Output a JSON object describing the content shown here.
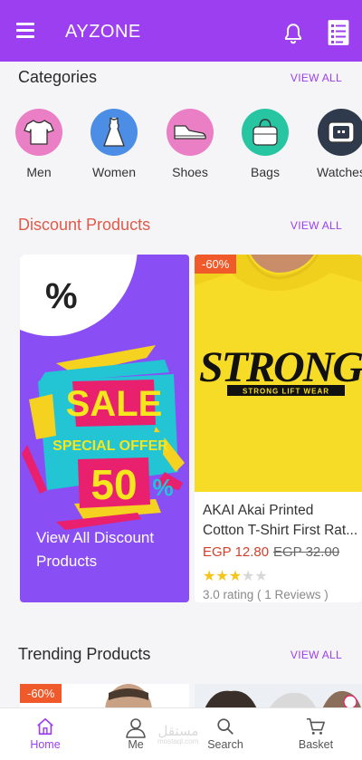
{
  "header": {
    "title": "AYZONE",
    "icons": [
      "menu-icon",
      "bell-icon",
      "list-icon"
    ]
  },
  "categories": {
    "title": "Categories",
    "view_all": "VIEW ALL",
    "items": [
      {
        "label": "Men",
        "icon": "tshirt-icon",
        "color": "#ea7fc5"
      },
      {
        "label": "Women",
        "icon": "dress-icon",
        "color": "#4c8ee6"
      },
      {
        "label": "Shoes",
        "icon": "shoe-icon",
        "color": "#ea7fc5"
      },
      {
        "label": "Bags",
        "icon": "bag-icon",
        "color": "#27c5a2"
      },
      {
        "label": "Watches",
        "icon": "watch-icon",
        "color": "#2f3b4d"
      }
    ]
  },
  "discount": {
    "title": "Discount Products",
    "view_all": "VIEW ALL",
    "title_color": "#e05a4a",
    "promo": {
      "percent_symbol": "%",
      "sale": "SALE",
      "special_offer": "SPECIAL OFFER",
      "fifty": "50",
      "fifty_pct": "%",
      "link_text": "View All Discount Products"
    },
    "product": {
      "badge": "-60%",
      "shirt_text": "STRONG",
      "shirt_subtext": "STRONG LIFT WEAR",
      "name_line1": "AKAI Akai Printed",
      "name_line2": "Cotton T-Shirt First Rat...",
      "price": "EGP 12.80",
      "old_price": "EGP 32.00",
      "rating_value": 3,
      "rating_max": 5,
      "rating_text": "3.0 rating ( 1 Reviews )"
    }
  },
  "trending": {
    "title": "Trending Products",
    "view_all": "VIEW ALL",
    "first_badge": "-60%"
  },
  "bottom_nav": {
    "items": [
      {
        "label": "Home",
        "icon": "home-icon",
        "active": true
      },
      {
        "label": "Me",
        "icon": "user-icon",
        "active": false
      },
      {
        "label": "Search",
        "icon": "search-icon",
        "active": false
      },
      {
        "label": "Basket",
        "icon": "basket-icon",
        "active": false
      }
    ],
    "watermark": "مستقل",
    "watermark_sub": "mostaql.com"
  },
  "colors": {
    "primary": "#9b3ff0",
    "promo_bg": "#8a4ef5",
    "badge": "#f05a2a",
    "price": "#d6402a",
    "star": "#f5c518"
  }
}
